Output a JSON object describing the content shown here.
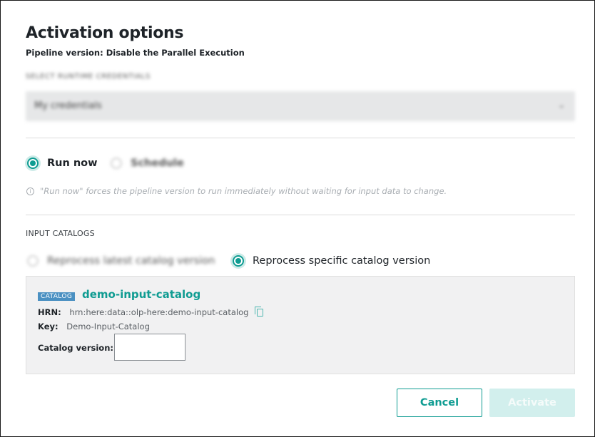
{
  "dialog": {
    "title": "Activation options",
    "subtitle": "Pipeline version: Disable the Parallel Execution"
  },
  "credentials": {
    "label": "SELECT RUNTIME CREDENTIALS",
    "selected": "My credentials"
  },
  "run_mode": {
    "options": [
      {
        "label": "Run now",
        "selected": true
      },
      {
        "label": "Schedule",
        "selected": false
      }
    ],
    "info_text": "\"Run now\" forces the pipeline version to run immediately without waiting for input data to change."
  },
  "input_catalogs": {
    "section_label": "INPUT CATALOGS",
    "options": [
      {
        "label": "Reprocess latest catalog version",
        "selected": false
      },
      {
        "label": "Reprocess specific catalog version",
        "selected": true
      }
    ],
    "catalog": {
      "badge": "CATALOG",
      "name": "demo-input-catalog",
      "hrn_label": "HRN:",
      "hrn_value": "hrn:here:data::olp-here:demo-input-catalog",
      "key_label": "Key:",
      "key_value": "Demo-Input-Catalog",
      "version_label": "Catalog version:",
      "version_value": ""
    }
  },
  "actions": {
    "cancel": "Cancel",
    "activate": "Activate"
  },
  "colors": {
    "accent": "#0f9c92",
    "badge": "#4a90c2",
    "activate_disabled": "#d2efed"
  }
}
